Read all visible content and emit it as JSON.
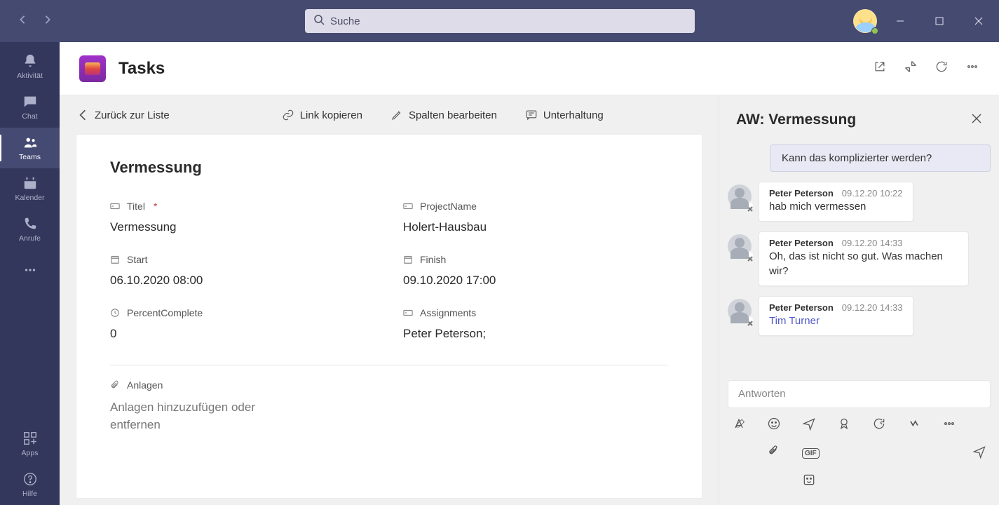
{
  "search": {
    "placeholder": "Suche"
  },
  "rail": {
    "activity": "Aktivität",
    "chat": "Chat",
    "teams": "Teams",
    "calendar": "Kalender",
    "calls": "Anrufe",
    "apps": "Apps",
    "help": "Hilfe"
  },
  "tab": {
    "title": "Tasks"
  },
  "toolbar": {
    "back": "Zurück zur Liste",
    "copy_link": "Link kopieren",
    "edit_columns": "Spalten bearbeiten",
    "conversation": "Unterhaltung"
  },
  "item": {
    "title": "Vermessung",
    "fields": {
      "title_label": "Titel",
      "title_value": "Vermessung",
      "project_label": "ProjectName",
      "project_value": "Holert-Hausbau",
      "start_label": "Start",
      "start_value": "06.10.2020 08:00",
      "finish_label": "Finish",
      "finish_value": "09.10.2020 17:00",
      "percent_label": "PercentComplete",
      "percent_value": "0",
      "assign_label": "Assignments",
      "assign_value": "Peter Peterson;"
    },
    "attachments_label": "Anlagen",
    "attachments_placeholder": "Anlagen hinzuzufügen oder entfernen"
  },
  "conv": {
    "title": "AW: Vermessung",
    "sys_msg": "Kann das komplizierter werden?",
    "messages": [
      {
        "name": "Peter Peterson",
        "time": "09.12.20 10:22",
        "text": "hab mich vermessen",
        "mention": ""
      },
      {
        "name": "Peter Peterson",
        "time": "09.12.20 14:33",
        "text": "Oh, das ist nicht so gut. Was machen wir?",
        "mention": ""
      },
      {
        "name": "Peter Peterson",
        "time": "09.12.20 14:33",
        "text": "",
        "mention": "Tim Turner"
      }
    ],
    "reply_placeholder": "Antworten"
  }
}
